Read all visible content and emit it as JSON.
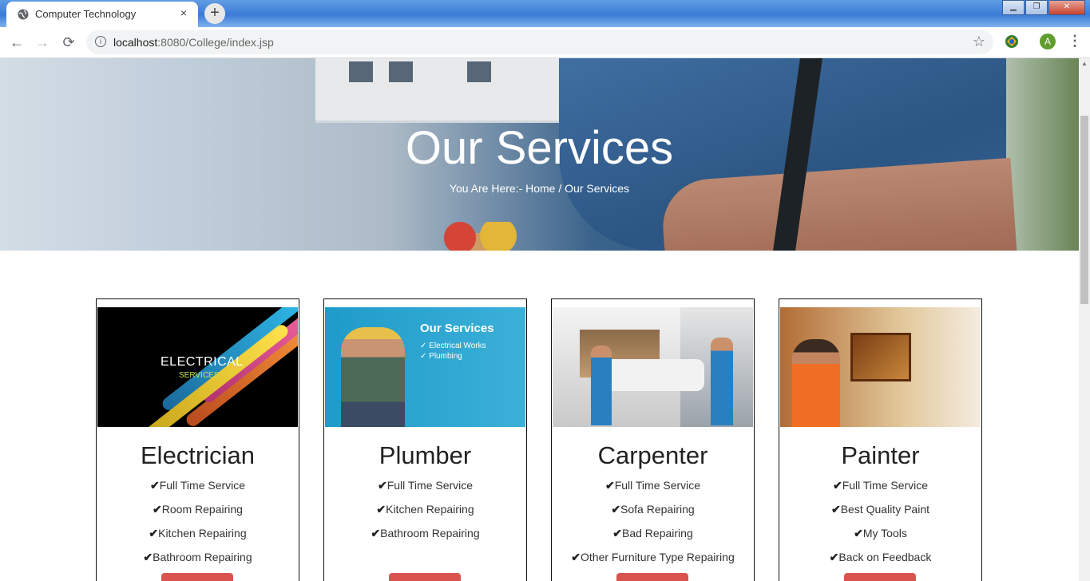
{
  "browser": {
    "tab_title": "Computer Technology",
    "tab_close": "×",
    "new_tab": "+",
    "url_host": "localhost",
    "url_rest": ":8080/College/index.jsp",
    "avatar_letter": "A",
    "back": "←",
    "forward": "→",
    "reload": "⟳",
    "star": "☆",
    "menu": "⋮"
  },
  "hero": {
    "title": "Our Services",
    "breadcrumb": "You Are Here:- Home / Our Services"
  },
  "services": [
    {
      "name": "Electrician",
      "image_label": "ELECTRICAL",
      "image_sub": "SERVICES",
      "features": [
        "Full Time Service",
        "Room Repairing",
        "Kitchen Repairing",
        "Bathroom Repairing"
      ]
    },
    {
      "name": "Plumber",
      "image_label": "Our Services",
      "image_sub_1": "✓ Electrical Works",
      "image_sub_2": "✓ Plumbing",
      "features": [
        "Full Time Service",
        "Kitchen Repairing",
        "Bathroom Repairing"
      ]
    },
    {
      "name": "Carpenter",
      "features": [
        "Full Time Service",
        "Sofa Repairing",
        "Bad Repairing",
        "Other Furniture Type Repairing"
      ]
    },
    {
      "name": "Painter",
      "features": [
        "Full Time Service",
        "Best Quality Paint",
        "My Tools",
        "Back on Feedback"
      ]
    }
  ],
  "colors": {
    "button": "#d9534f",
    "titlebar": "#3b7bd6",
    "avatar": "#5f9e2c"
  }
}
